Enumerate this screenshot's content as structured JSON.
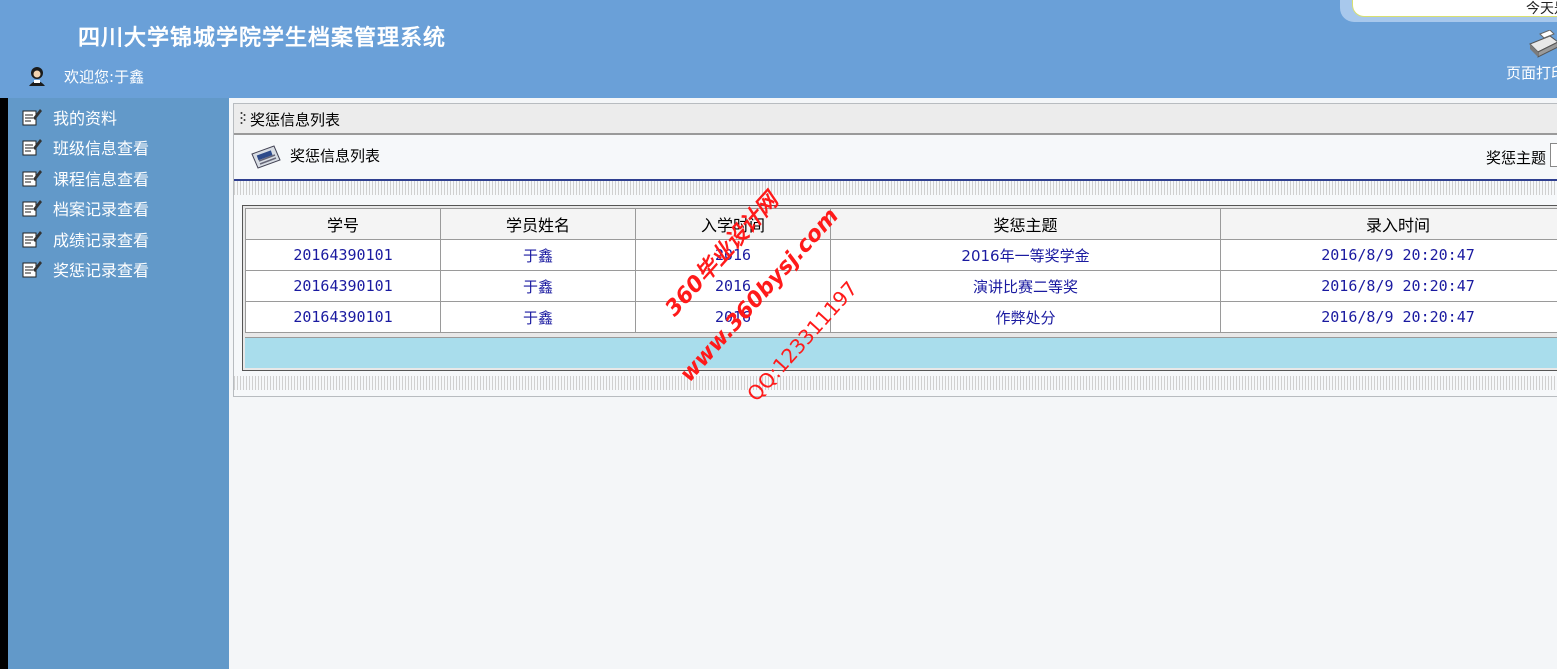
{
  "header": {
    "app_title": "四川大学锦城学院学生档案管理系统",
    "welcome_prefix": "欢迎您:",
    "user_name": "于鑫",
    "date_text": "今天是",
    "print_label": "页面打印"
  },
  "sidebar": {
    "items": [
      {
        "label": "我的资料"
      },
      {
        "label": "班级信息查看"
      },
      {
        "label": "课程信息查看"
      },
      {
        "label": "档案记录查看"
      },
      {
        "label": "成绩记录查看"
      },
      {
        "label": "奖惩记录查看"
      }
    ]
  },
  "panel": {
    "title": "奖惩信息列表",
    "toolbar_title": "奖惩信息列表",
    "filter_label": "奖惩主题"
  },
  "table": {
    "columns": [
      "学号",
      "学员姓名",
      "入学时间",
      "奖惩主题",
      "录入时间"
    ],
    "rows": [
      [
        "20164390101",
        "于鑫",
        "2016",
        "2016年一等奖学金",
        "2016/8/9 20:20:47"
      ],
      [
        "20164390101",
        "于鑫",
        "2016",
        "演讲比赛二等奖",
        "2016/8/9 20:20:47"
      ],
      [
        "20164390101",
        "于鑫",
        "2016",
        "作弊处分",
        "2016/8/9 20:20:47"
      ]
    ]
  },
  "watermark": {
    "line1": "360毕业设计网",
    "line2": "www.360bysj.com",
    "line3": "QQ:123311197"
  },
  "colors": {
    "header_bg": "#6aa0d8",
    "sidebar_bg": "#6299c9",
    "link_text": "#1a1aa0",
    "table_footer": "#a9ddec",
    "watermark": "#ff1a1a"
  }
}
